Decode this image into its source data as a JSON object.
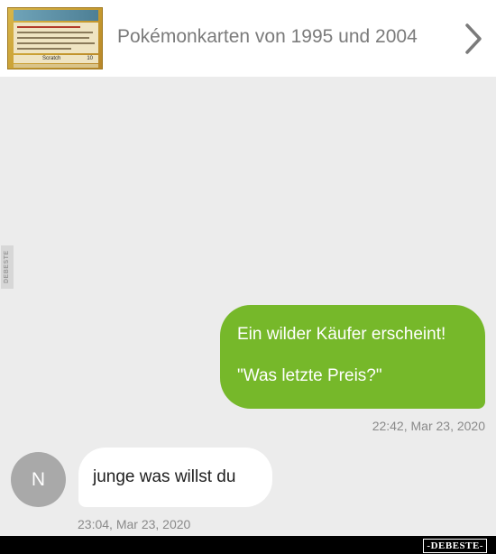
{
  "header": {
    "title": "Pokémonkarten von 1995 und 2004",
    "thumbnail_icon": "pokemon-card-thumbnail",
    "thumbnail_attack": "Scratch",
    "thumbnail_damage": "10",
    "chevron_icon": "chevron-right-icon"
  },
  "side_watermark": "DEBESTE",
  "messages": {
    "outgoing": {
      "line1": "Ein wilder Käufer erscheint!",
      "line2": "\"Was letzte Preis?\"",
      "timestamp": "22:42, Mar 23, 2020",
      "color": "#76b82a"
    },
    "incoming": {
      "avatar_initial": "N",
      "text": "junge was willst du",
      "timestamp": "23:04, Mar 23, 2020"
    }
  },
  "footer": {
    "brand": "-DEBESTE-"
  }
}
